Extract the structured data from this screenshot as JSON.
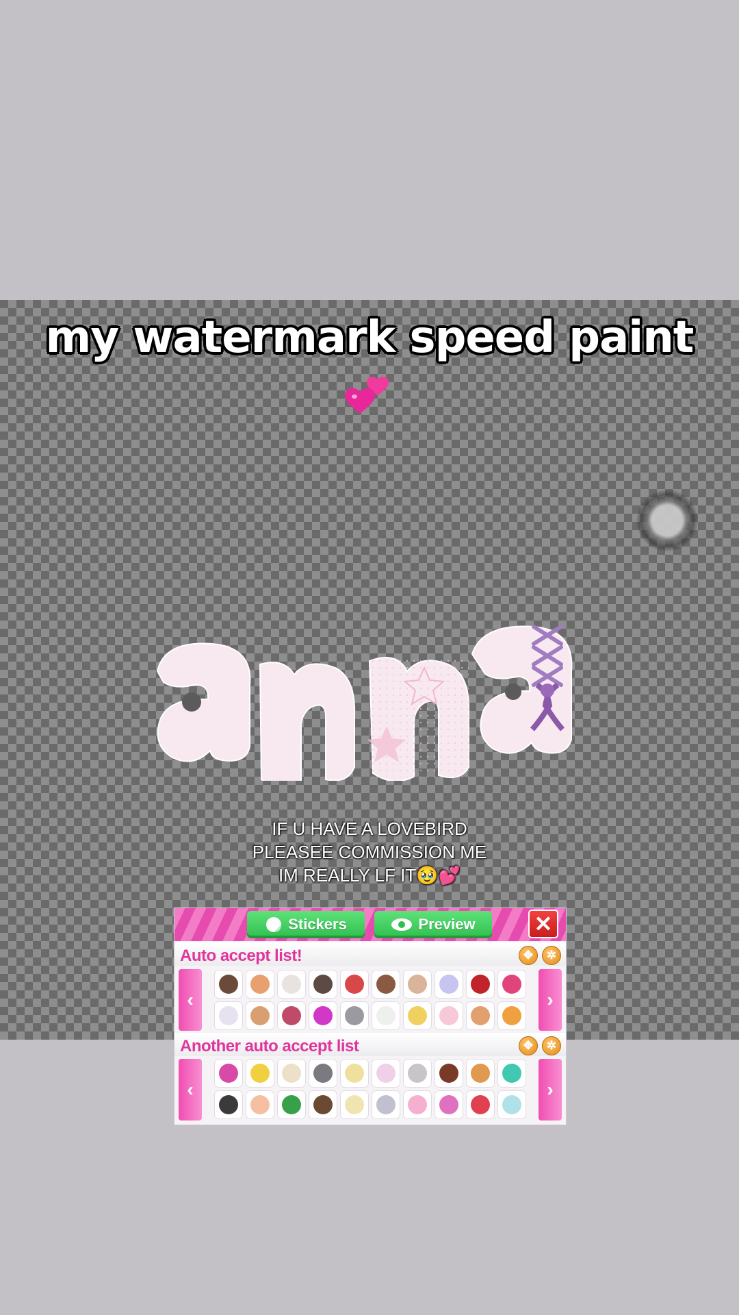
{
  "caption": {
    "text": "my watermark speed paint",
    "emoji": "💕"
  },
  "watermark": {
    "text": "anna"
  },
  "note": {
    "lines": [
      "IF U HAVE A LOVEBIRD",
      "PLEASEE COMMISSION ME",
      "IM REALLY LF IT🥹💕"
    ]
  },
  "panel": {
    "tabs": {
      "stickers": "Stickers",
      "preview": "Preview"
    },
    "close_label": "✕",
    "lists": [
      {
        "title": "Auto accept list!",
        "left_arrow": "‹",
        "right_arrow": "›",
        "pet_colors": [
          "#6b4a3a",
          "#e8a070",
          "#e9e3e0",
          "#5e4a44",
          "#d84848",
          "#8a5a42",
          "#d9b39a",
          "#c8c4f0",
          "#c0242a",
          "#e0447a",
          "#e6e2f0",
          "#d8a070",
          "#c04a6a",
          "#d238c8",
          "#9a9aa0",
          "#eef0ee",
          "#f0d060",
          "#f7c8d8",
          "#e0a070",
          "#f0a040"
        ]
      },
      {
        "title": "Another auto accept list",
        "left_arrow": "‹",
        "right_arrow": "›",
        "pet_colors": [
          "#d84aa8",
          "#f0d040",
          "#ece0c8",
          "#7a7a80",
          "#f0e0a0",
          "#f0d0e8",
          "#c8c4c8",
          "#7a3a28",
          "#e09a50",
          "#40c8b0",
          "#3a3a3a",
          "#f5c0a0",
          "#38a048",
          "#6a4a32",
          "#f0e4b0",
          "#c0c0d0",
          "#f5b0d0",
          "#e070c0",
          "#e04050",
          "#b0e0e8"
        ]
      }
    ]
  }
}
